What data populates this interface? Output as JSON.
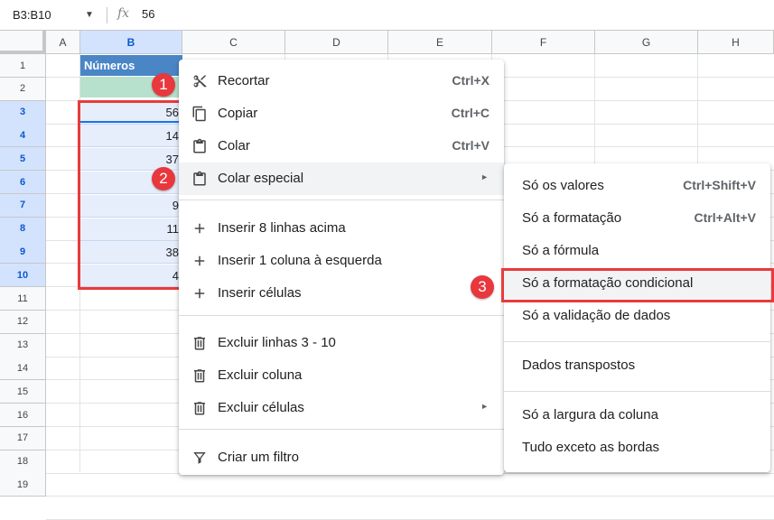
{
  "formula_bar": {
    "name_box": "B3:B10",
    "fx_label": "fx",
    "value": "56"
  },
  "columns": [
    "A",
    "B",
    "C",
    "D",
    "E",
    "F",
    "G",
    "H"
  ],
  "rows": [
    "1",
    "2",
    "3",
    "4",
    "5",
    "6",
    "7",
    "8",
    "9",
    "10",
    "11",
    "12",
    "13",
    "14",
    "15",
    "16",
    "17",
    "18",
    "19"
  ],
  "cells": {
    "b1": "Números",
    "b_values": [
      "56",
      "14",
      "37",
      "",
      "9",
      "11",
      "38",
      "4"
    ]
  },
  "context_menu": {
    "items": [
      {
        "label": "Recortar",
        "shortcut": "Ctrl+X",
        "icon": "scissors-icon"
      },
      {
        "label": "Copiar",
        "shortcut": "Ctrl+C",
        "icon": "copy-icon"
      },
      {
        "label": "Colar",
        "shortcut": "Ctrl+V",
        "icon": "clipboard-icon"
      },
      {
        "label": "Colar especial",
        "icon": "clipboard-icon",
        "submenu": true
      },
      {
        "label": "Inserir 8 linhas acima",
        "icon": "plus-icon"
      },
      {
        "label": "Inserir 1 coluna à esquerda",
        "icon": "plus-icon"
      },
      {
        "label": "Inserir células",
        "icon": "plus-icon"
      },
      {
        "label": "Excluir linhas 3 - 10",
        "icon": "trash-icon"
      },
      {
        "label": "Excluir coluna",
        "icon": "trash-icon"
      },
      {
        "label": "Excluir células",
        "icon": "trash-icon",
        "submenu": true
      },
      {
        "label": "Criar um filtro",
        "icon": "filter-icon"
      }
    ]
  },
  "paste_special_menu": {
    "items": [
      {
        "label": "Só os valores",
        "shortcut": "Ctrl+Shift+V"
      },
      {
        "label": "Só a formatação",
        "shortcut": "Ctrl+Alt+V"
      },
      {
        "label": "Só a fórmula"
      },
      {
        "label": "Só a formatação condicional"
      },
      {
        "label": "Só a validação de dados"
      },
      {
        "label": "Dados transpostos"
      },
      {
        "label": "Só a largura da coluna"
      },
      {
        "label": "Tudo exceto as bordas"
      }
    ]
  },
  "badges": [
    "1",
    "2",
    "3"
  ],
  "colors": {
    "accent": "#e8383d",
    "header_blue": "#4a86c6",
    "selection": "#d3e3fd"
  }
}
